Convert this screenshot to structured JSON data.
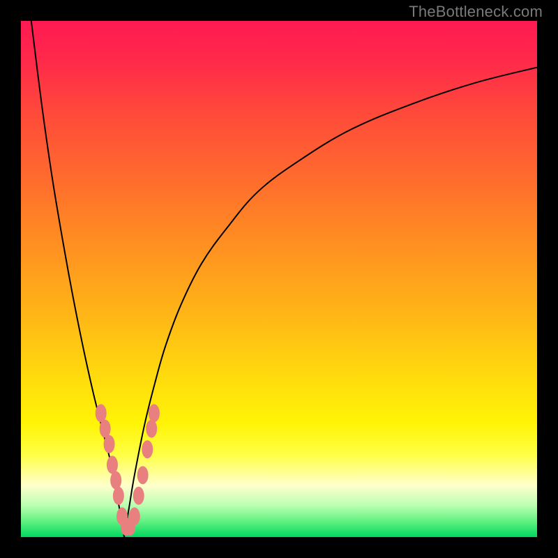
{
  "watermark": {
    "text": "TheBottleneck.com"
  },
  "gradient": {
    "stops": [
      {
        "offset": 0.0,
        "color": "#ff1a52"
      },
      {
        "offset": 0.08,
        "color": "#ff2a4a"
      },
      {
        "offset": 0.18,
        "color": "#ff4a3a"
      },
      {
        "offset": 0.3,
        "color": "#ff6a2e"
      },
      {
        "offset": 0.42,
        "color": "#ff8c22"
      },
      {
        "offset": 0.55,
        "color": "#ffb018"
      },
      {
        "offset": 0.68,
        "color": "#ffd80e"
      },
      {
        "offset": 0.78,
        "color": "#fff406"
      },
      {
        "offset": 0.84,
        "color": "#ffff44"
      },
      {
        "offset": 0.9,
        "color": "#ffffcc"
      },
      {
        "offset": 0.94,
        "color": "#b8ffb0"
      },
      {
        "offset": 0.97,
        "color": "#60f080"
      },
      {
        "offset": 1.0,
        "color": "#00d860"
      }
    ]
  },
  "chart_data": {
    "type": "line",
    "title": "",
    "xlabel": "",
    "ylabel": "",
    "xlim": [
      0,
      100
    ],
    "ylim": [
      0,
      100
    ],
    "notch_x": 20,
    "series": [
      {
        "name": "left-curve",
        "x": [
          2,
          4,
          6,
          8,
          10,
          12,
          14,
          16,
          18,
          19,
          20
        ],
        "values": [
          100,
          84,
          70,
          58,
          47,
          37,
          28,
          20,
          12,
          6,
          0
        ]
      },
      {
        "name": "right-curve",
        "x": [
          20,
          21,
          22,
          24,
          26,
          28,
          31,
          35,
          40,
          46,
          54,
          64,
          76,
          88,
          100
        ],
        "values": [
          0,
          6,
          12,
          22,
          30,
          37,
          45,
          53,
          60,
          67,
          73,
          79,
          84,
          88,
          91
        ]
      },
      {
        "name": "marker-dots",
        "x": [
          15.5,
          16.3,
          17.1,
          17.7,
          18.4,
          18.9,
          19.6,
          20.4,
          21.1,
          22.0,
          22.8,
          23.6,
          24.5,
          25.3,
          25.8
        ],
        "values": [
          24,
          21,
          18,
          14,
          11,
          8,
          4,
          2,
          2,
          4,
          8,
          12,
          17,
          21,
          24
        ]
      }
    ]
  }
}
